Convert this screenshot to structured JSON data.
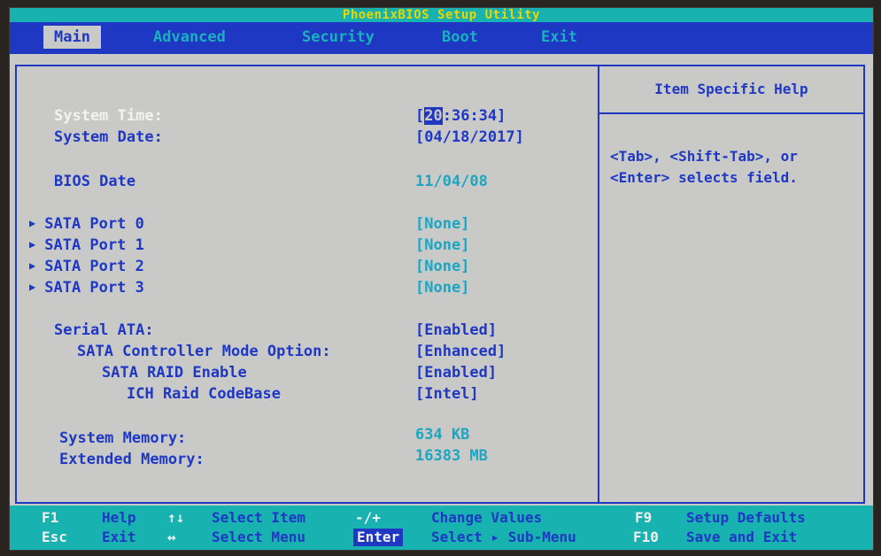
{
  "title": "PhoenixBIOS Setup Utility",
  "menu": [
    "Main",
    "Advanced",
    "Security",
    "Boot",
    "Exit"
  ],
  "main": {
    "system_time": {
      "label": "System Time:",
      "value_rest": ":36:34]",
      "value_prefix": "[",
      "cursor": "20"
    },
    "system_date": {
      "label": "System Date:",
      "value": "[04/18/2017]"
    },
    "bios_date": {
      "label": "BIOS Date",
      "value": "11/04/08"
    },
    "sata_ports": [
      {
        "label": "SATA Port 0",
        "value": "[None]"
      },
      {
        "label": "SATA Port 1",
        "value": "[None]"
      },
      {
        "label": "SATA Port 2",
        "value": "[None]"
      },
      {
        "label": "SATA Port 3",
        "value": "[None]"
      }
    ],
    "serial_ata": {
      "label": "Serial ATA:",
      "value": "[Enabled]"
    },
    "sata_controller_mode": {
      "label": "SATA Controller Mode Option:",
      "value": "[Enhanced]"
    },
    "sata_raid_enable": {
      "label": "SATA RAID Enable",
      "value": "[Enabled]"
    },
    "ich_raid_codebase": {
      "label": "ICH Raid CodeBase",
      "value": "[Intel]"
    },
    "system_memory": {
      "label": "System Memory:",
      "value": "634 KB"
    },
    "extended_memory": {
      "label": "Extended Memory:",
      "value": "16383 MB"
    }
  },
  "help": {
    "title": "Item Specific Help",
    "line1": "<Tab>, <Shift-Tab>, or",
    "line2": "<Enter> selects field."
  },
  "status": {
    "row1": {
      "k1": "F1",
      "d1": "Help",
      "k2": "↑↓",
      "d2": "Select Item",
      "k3": "-/+",
      "d3": "Change Values",
      "k4": "F9",
      "d4": "Setup Defaults"
    },
    "row2": {
      "k1": "Esc",
      "d1": "Exit",
      "k2": "↔",
      "d2": "Select Menu",
      "k3": "Enter",
      "d3": "Select ▸ Sub-Menu",
      "k4": "F10",
      "d4": "Save and Exit"
    }
  }
}
